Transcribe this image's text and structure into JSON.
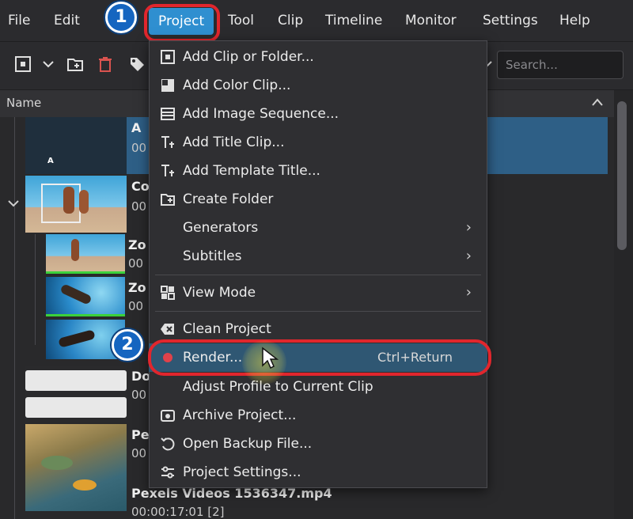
{
  "menubar": {
    "items": [
      {
        "label": "File"
      },
      {
        "label": "Edit"
      },
      {
        "label": "Project"
      },
      {
        "label": "Tool"
      },
      {
        "label": "Clip"
      },
      {
        "label": "Timeline"
      },
      {
        "label": "Monitor"
      },
      {
        "label": "Settings"
      },
      {
        "label": "Help"
      }
    ],
    "active": "Project"
  },
  "annotations": {
    "badge1": "1",
    "badge2": "2",
    "ring_color": "#e1262d",
    "badge_color": "#1565c0"
  },
  "toolbar": {
    "search_placeholder": "Search..."
  },
  "bin": {
    "header_label": "Name",
    "rows": [
      {
        "name": "A",
        "sub": "00",
        "thumb_letter": "A"
      },
      {
        "name": "Co",
        "sub": "00"
      },
      {
        "name": "Zo",
        "sub": "00"
      },
      {
        "name": "Zo",
        "sub": "00"
      },
      {
        "name": "",
        "sub": ""
      },
      {
        "name": "Do",
        "sub": "00"
      },
      {
        "name": "Pe",
        "sub": "00"
      },
      {
        "name": "Pexels Videos 1536347.mp4",
        "sub": "00:00:17:01 [2]"
      }
    ]
  },
  "project_menu": {
    "items": [
      {
        "label": "Add Clip or Folder...",
        "icon": "add-clip-icon"
      },
      {
        "label": "Add Color Clip...",
        "icon": "color-clip-icon"
      },
      {
        "label": "Add Image Sequence...",
        "icon": "image-sequence-icon"
      },
      {
        "label": "Add Title Clip...",
        "icon": "title-clip-icon"
      },
      {
        "label": "Add Template Title...",
        "icon": "template-title-icon"
      },
      {
        "label": "Create Folder",
        "icon": "create-folder-icon"
      },
      {
        "label": "Generators",
        "submenu": true
      },
      {
        "label": "Subtitles",
        "submenu": true
      },
      {
        "label": "View Mode",
        "icon": "view-mode-icon",
        "submenu": true
      },
      {
        "label": "Clean Project",
        "icon": "clean-project-icon"
      },
      {
        "label": "Render...",
        "icon": "render-icon",
        "shortcut": "Ctrl+Return",
        "highlighted": true
      },
      {
        "label": "Adjust Profile to Current Clip"
      },
      {
        "label": "Archive Project...",
        "icon": "archive-icon"
      },
      {
        "label": "Open Backup File...",
        "icon": "backup-icon"
      },
      {
        "label": "Project Settings...",
        "icon": "settings-icon"
      }
    ],
    "submenu_arrow": "›"
  },
  "colors": {
    "accent": "#2f8fd0",
    "selection": "#2e5f86",
    "render_dot": "#e0424a"
  }
}
